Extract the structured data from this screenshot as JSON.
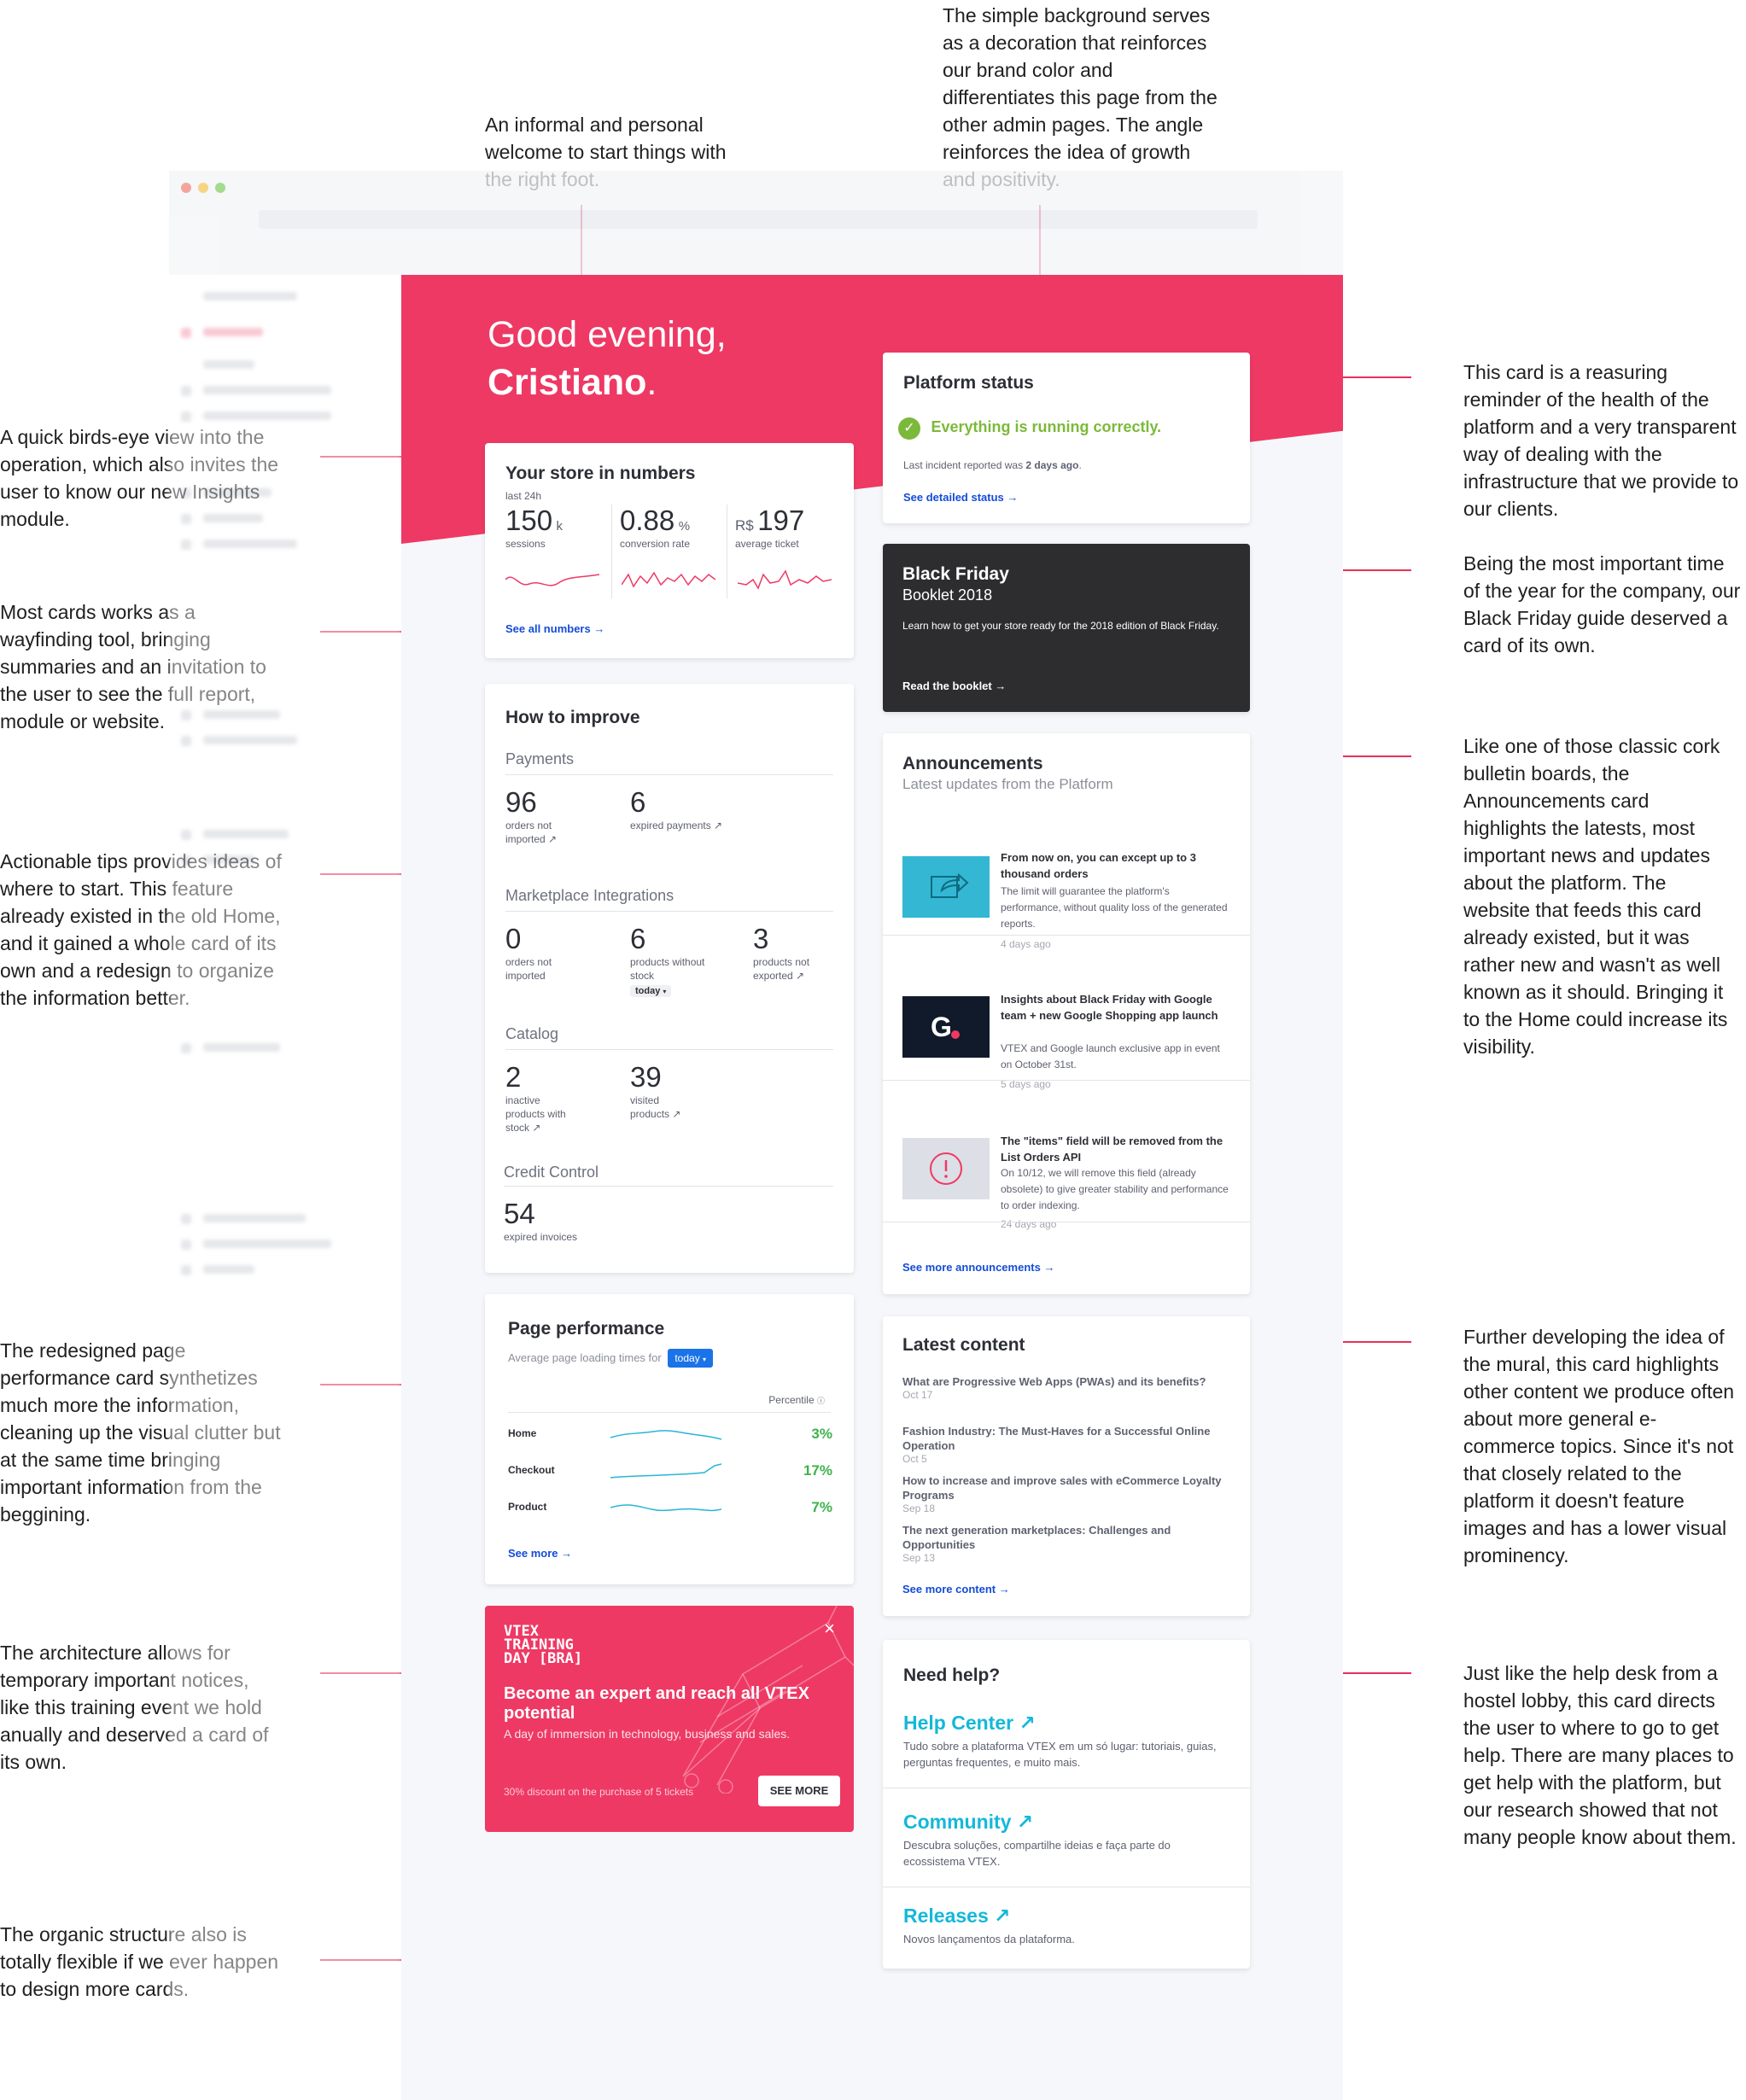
{
  "annotations": {
    "welcome": "An informal and personal welcome to start things with the right foot.",
    "background": "The simple background serves as a decoration that reinforces our brand color and differentiates this page from the other admin pages. The angle reinforces the idea of growth and positivity.",
    "platform_status": "This card is a reasuring reminder of the health of the platform and a very transparent way of dealing with the infrastructure that we provide to our clients.",
    "black_friday": "Being the most important time of the year for the company, our Black Friday guide deserved a card of its own.",
    "announcements": "Like one of those classic cork bulletin boards, the Announcements card highlights the latests, most important news and updates about the platform. The website that feeds this card already existed, but it was rather new and wasn't as well known as it should. Bringing it to the Home could increase its visibility.",
    "latest_content": "Further developing the idea of the mural, this card highlights other content we produce often about more general e-commerce topics. Since it's not that closely related to the platform it doesn't feature images and has a lower visual prominency.",
    "need_help": "Just like the help desk from a hostel lobby, this card directs the user to where to go to get help. There are many places to get help with the platform, but our research showed that not many people know about them.",
    "store_numbers": "A quick birds-eye view into the operation, which also invites the user to know our  new Insights module.",
    "wayfinding": "Most cards works as a wayfinding tool, bringing summaries and an invitation to the user to see the full report, module or website.",
    "tips": "Actionable tips provides ideas of where to start. This feature already existed in the old Home, and it gained a whole card of its own and a redesign to organize the information better.",
    "page_performance": "The redesigned page performance card synthetizes much more the information, cleaning up the visual clutter but at the same time bringing important information from the beggining.",
    "architecture": "The architecture allows for temporary important notices, like this training event we hold anually and deserved a card of its own.",
    "organic": "The organic structure also is totally flexible if we ever happen to design more cards."
  },
  "greeting": {
    "line1": "Good evening,",
    "name": "Cristiano",
    "period": "."
  },
  "store_numbers": {
    "title": "Your store in numbers",
    "subtitle": "last 24h",
    "metrics": [
      {
        "value": "150",
        "unit": "k",
        "label": "sessions"
      },
      {
        "value": "0.88",
        "unit": "%",
        "label": "conversion rate"
      },
      {
        "prefix": "R$",
        "value": "197",
        "label": "average ticket"
      }
    ],
    "link": "See all numbers →"
  },
  "how_to_improve": {
    "title": "How to improve",
    "sections": {
      "payments": {
        "heading": "Payments",
        "items": [
          {
            "value": "96",
            "label": "orders not imported ↗"
          },
          {
            "value": "6",
            "label": "expired payments ↗"
          }
        ]
      },
      "marketplace": {
        "heading": "Marketplace Integrations",
        "items": [
          {
            "value": "0",
            "label": "orders not imported"
          },
          {
            "value": "6",
            "label": "products without stock"
          },
          {
            "value": "3",
            "label": "products not exported ↗"
          }
        ],
        "select": "today"
      },
      "catalog": {
        "heading": "Catalog",
        "items": [
          {
            "value": "2",
            "label": "inactive products with stock ↗"
          },
          {
            "value": "39",
            "label": "visited products ↗"
          }
        ]
      },
      "credit": {
        "heading": "Credit Control",
        "items": [
          {
            "value": "54",
            "label": "expired invoices"
          }
        ]
      }
    }
  },
  "page_performance": {
    "title": "Page performance",
    "subtitle": "Average page loading times for",
    "select": "today",
    "column": "Percentile",
    "rows": [
      {
        "page": "Home",
        "percent": "3%"
      },
      {
        "page": "Checkout",
        "percent": "17%"
      },
      {
        "page": "Product",
        "percent": "7%"
      }
    ],
    "link": "See more →"
  },
  "training": {
    "logo_line1": "VTEX",
    "logo_line2": "TRAINING",
    "logo_line3": "DAY [BRA]",
    "headline": "Become an expert and reach all VTEX potential",
    "body": "A day of immersion in technology, business and sales.",
    "discount": "30% discount on the purchase of 5 tickets",
    "button": "SEE MORE",
    "close": "×"
  },
  "platform_status": {
    "title": "Platform status",
    "status": "Everything is running correctly.",
    "incident_prefix": "Last incident reported was ",
    "incident_value": "2 days ago",
    "incident_suffix": ".",
    "link": "See detailed status →"
  },
  "black_friday": {
    "title": "Black Friday",
    "subtitle": "Booklet 2018",
    "body": "Learn how to get your store ready for the 2018 edition of Black Friday.",
    "link": "Read the booklet →"
  },
  "announcements": {
    "title": "Announcements",
    "subtitle": "Latest updates from the Platform",
    "items": [
      {
        "title": "From now on, you can except up to 3 thousand orders",
        "body": "The limit will guarantee the platform's performance, without quality loss of the generated reports.",
        "date": "4 days ago"
      },
      {
        "title": "Insights about Black Friday with Google team + new Google Shopping app launch",
        "body": "VTEX and Google launch exclusive app in event on October 31st.",
        "date": "5 days ago"
      },
      {
        "title": "The \"items\" field will be removed from the List Orders API",
        "body": "On 10/12, we will remove this field (already obsolete) to give greater stability and performance to order indexing.",
        "date": "24 days ago"
      }
    ],
    "link": "See more announcements →"
  },
  "latest_content": {
    "title": "Latest content",
    "items": [
      {
        "title": "What are Progressive Web Apps (PWAs) and its benefits?",
        "date": "Oct 17"
      },
      {
        "title": "Fashion Industry: The Must-Haves for a Successful Online Operation",
        "date": "Oct 5"
      },
      {
        "title": "How to increase and improve sales with eCommerce Loyalty Programs",
        "date": "Sep 18"
      },
      {
        "title": "The next generation marketplaces: Challenges and Opportunities",
        "date": "Sep 13"
      }
    ],
    "link": "See more content →"
  },
  "need_help": {
    "title": "Need help?",
    "items": [
      {
        "title": "Help Center ↗",
        "body": "Tudo sobre a plataforma VTEX em um só lugar: tutoriais, guias, perguntas frequentes, e muito mais."
      },
      {
        "title": "Community ↗",
        "body": "Descubra soluções, compartilhe ideias e faça parte do ecossistema VTEX."
      },
      {
        "title": "Releases ↗",
        "body": "Novos lançamentos da plataforma."
      }
    ]
  },
  "colors": {
    "brand": "#ee3964",
    "annotation_line": "#e8305a",
    "link": "#134cd8",
    "success": "#7cb93a",
    "help_link": "#14b8d8",
    "dark_card": "#2d2d2f"
  },
  "icons": [
    "check-circle-icon",
    "share-icon",
    "google-g-icon",
    "alert-circle-icon",
    "close-icon",
    "external-arrow-icon"
  ]
}
